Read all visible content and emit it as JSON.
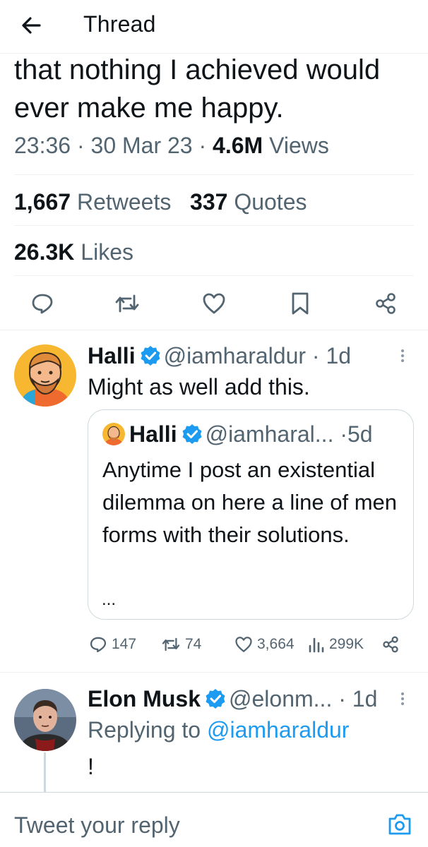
{
  "header": {
    "title": "Thread",
    "back_icon": "arrow-left-icon"
  },
  "tweet": {
    "text": "that nothing I achieved would ever make me happy.",
    "time": "23:36",
    "sep1": "·",
    "date": "30 Mar 23",
    "sep2": "·",
    "views_count": "4.6M",
    "views_label": "Views",
    "retweets_count": "1,667",
    "retweets_label": "Retweets",
    "quotes_count": "337",
    "quotes_label": "Quotes",
    "likes_count": "26.3K",
    "likes_label": "Likes",
    "actions": [
      "reply-icon",
      "retweet-icon",
      "like-icon",
      "bookmark-icon",
      "share-icon"
    ]
  },
  "reply1": {
    "name": "Halli",
    "handle": "@iamharaldur",
    "dot": "·",
    "age": "1d",
    "text": "Might as well add this.",
    "quote": {
      "name": "Halli",
      "handle": "@iamharal...",
      "dot": "·",
      "age": "5d",
      "text": "Anytime I post an existential dilemma on here a line of men forms with their solutions.",
      "ellipsis": "..."
    },
    "metrics": {
      "replies": "147",
      "retweets": "74",
      "likes": "3,664",
      "views": "299K"
    }
  },
  "reply2": {
    "name": "Elon Musk",
    "handle": "@elonm...",
    "dot": "·",
    "age": "1d",
    "replying_prefix": "Replying to",
    "replying_to": "@iamharaldur",
    "text": "!"
  },
  "reply_bar": {
    "placeholder": "Tweet your reply",
    "camera_icon": "camera-icon"
  },
  "colors": {
    "accent": "#1d9bf0",
    "text": "#0f1419",
    "muted": "#536471",
    "divider": "#eff3f4"
  }
}
